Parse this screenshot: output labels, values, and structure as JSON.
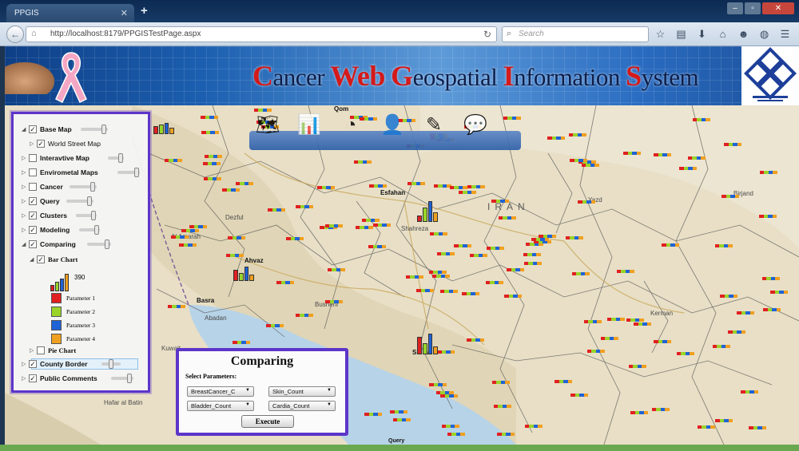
{
  "browser": {
    "tab_title": "PPGIS",
    "url": "http://localhost:8179/PPGISTestPage.aspx",
    "search_placeholder": "Search"
  },
  "header": {
    "title_parts": [
      {
        "cap": "C",
        "rest": "ancer "
      },
      {
        "cap": "Web",
        "rest": " "
      },
      {
        "cap": "G",
        "rest": "eospatial "
      },
      {
        "cap": "I",
        "rest": "nformation "
      },
      {
        "cap": "S",
        "rest": "ystem"
      }
    ],
    "accent_color": "#d41a1a"
  },
  "layers": {
    "items": [
      {
        "label": "Base Map",
        "checked": true
      },
      {
        "label": "World Street Map",
        "checked": true
      },
      {
        "label": "Interavtive Map",
        "checked": false
      },
      {
        "label": "Envirometal Maps",
        "checked": false
      },
      {
        "label": "Cancer",
        "checked": false
      },
      {
        "label": "Query",
        "checked": true
      },
      {
        "label": "Clusters",
        "checked": true
      },
      {
        "label": "Modeling",
        "checked": true
      },
      {
        "label": "Comparing",
        "checked": true
      },
      {
        "label": "Bar Chart",
        "checked": true
      },
      {
        "label": "Pie Chart",
        "checked": false
      },
      {
        "label": "County Border",
        "checked": true
      },
      {
        "label": "Public Comments",
        "checked": true
      }
    ],
    "legend_value": "390",
    "legend": [
      {
        "label": "Parameter 1",
        "color": "#e02020"
      },
      {
        "label": "Parameter 2",
        "color": "#9ad42a"
      },
      {
        "label": "Parameter 3",
        "color": "#1f63d6"
      },
      {
        "label": "Parameter 4",
        "color": "#f0a020"
      }
    ]
  },
  "comparing": {
    "title": "Comparing",
    "select_label": "Select Parameters:",
    "dropdowns": [
      "BreastCancer_C",
      "Skin_Count",
      "Bladder_Count",
      "Cardia_Count"
    ],
    "execute_label": "Execute"
  },
  "map": {
    "country_label": "IRAN",
    "cities": [
      "Esfahan",
      "Ahvaz",
      "Shiraz",
      "Basra",
      "Qom",
      "Kerman",
      "Bushehr",
      "Yazd",
      "Birjand",
      "Dezful",
      "Shahreza",
      "Abadan",
      "Al Amarah",
      "Hafar al Batin",
      "Kuwait"
    ],
    "query_label": "Query"
  }
}
